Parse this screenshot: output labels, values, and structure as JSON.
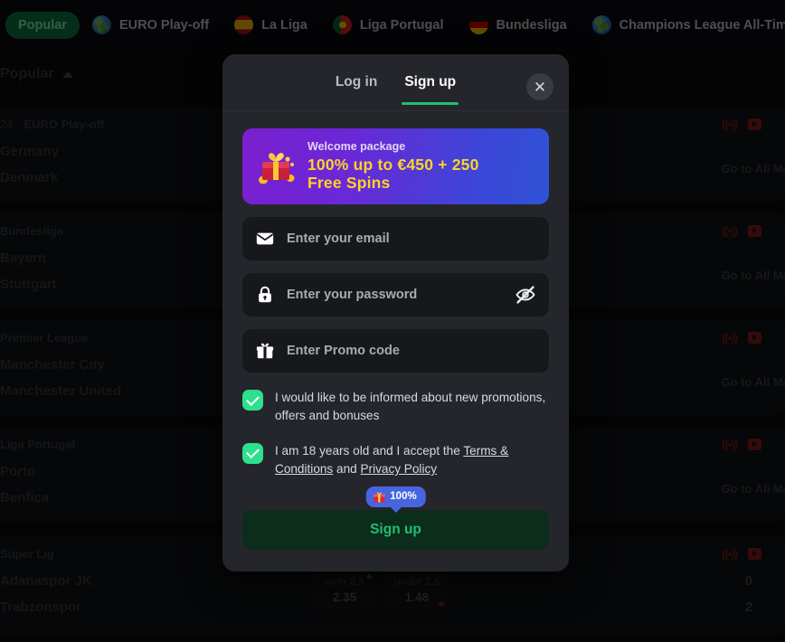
{
  "topnav": {
    "items": [
      {
        "label": "Popular",
        "icon": "none",
        "active": true
      },
      {
        "label": "EURO Play-off",
        "icon": "globe-icon",
        "active": false
      },
      {
        "label": "La Liga",
        "icon": "flag-spain-icon",
        "active": false
      },
      {
        "label": "Liga Portugal",
        "icon": "flag-portugal-icon",
        "active": false
      },
      {
        "label": "Bundesliga",
        "icon": "flag-germany-icon",
        "active": false
      },
      {
        "label": "Champions League All-Time",
        "icon": "globe-icon",
        "active": false
      },
      {
        "label": "",
        "icon": "globe-icon",
        "active": false
      }
    ]
  },
  "background": {
    "section_title": "Popular",
    "all_markets_label": "Go to All Markets",
    "matches": [
      {
        "time": "24",
        "league": "EURO Play-off",
        "home": "Germany",
        "away": "Denmark",
        "home_score": "",
        "away_score": ""
      },
      {
        "time": "",
        "league": "Bundesliga",
        "home": "Bayern",
        "away": "Stuttgart",
        "home_score": "",
        "away_score": ""
      },
      {
        "time": "",
        "league": "Premier League",
        "home": "Manchester City",
        "away": "Manchester United",
        "home_score": "",
        "away_score": ""
      },
      {
        "time": "",
        "league": "Liga Portugal",
        "home": "Porto",
        "away": "Benfica",
        "home_score": "",
        "away_score": ""
      },
      {
        "time": "",
        "league": "Süper Lig",
        "home": "Adanaspor JK",
        "away": "Trabzonspor",
        "home_score": "0",
        "away_score": "2"
      }
    ],
    "odds": [
      {
        "label": "over 2.5",
        "value": "2.35",
        "trend": "up"
      },
      {
        "label": "under 2.5",
        "value": "1.48",
        "trend": "down"
      }
    ]
  },
  "modal": {
    "tabs": [
      {
        "label": "Log in",
        "active": false
      },
      {
        "label": "Sign up",
        "active": true
      }
    ],
    "close_label": "✕",
    "promo": {
      "kicker": "Welcome package",
      "line1": "100% up to €450 + 250",
      "line2": "Free Spins"
    },
    "fields": [
      {
        "name": "email",
        "placeholder": "Enter your email",
        "value": "",
        "icon": "envelope-icon"
      },
      {
        "name": "password",
        "placeholder": "Enter your password",
        "value": "",
        "icon": "lock-icon"
      },
      {
        "name": "promo",
        "placeholder": "Enter Promo code",
        "value": "",
        "icon": "gift-icon"
      }
    ],
    "checkboxes": [
      {
        "checked": true,
        "text": "I would like to be informed about new promotions, offers and bonuses"
      },
      {
        "checked": true,
        "text_before": "I am 18 years old and I accept the ",
        "link1": "Terms & Conditions",
        "text_middle": " and ",
        "link2": "Privacy Policy"
      }
    ],
    "tooltip_text": "100%",
    "submit_label": "Sign up"
  },
  "colors": {
    "accent_green": "#1fbf72",
    "checkbox_green": "#2de08c",
    "tooltip_blue": "#4765e0",
    "promo_yellow": "#ffd426",
    "modal_bg": "#25262b",
    "field_bg": "#17181c"
  }
}
